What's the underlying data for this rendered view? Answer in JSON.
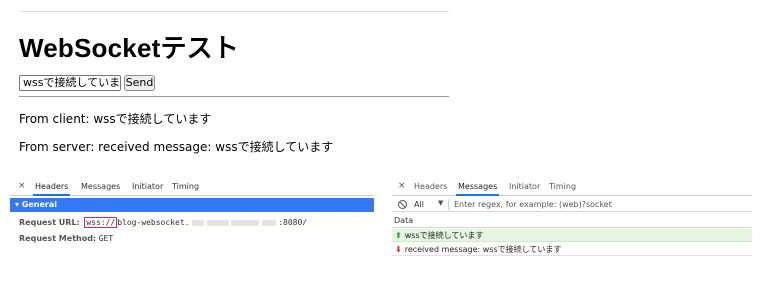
{
  "page": {
    "title": "WebSocketテスト",
    "input_value": "wssで接続しています",
    "send_label": "Send",
    "from_client": "From client: wssで接続しています",
    "from_server": "From server: received message: wssで接続しています"
  },
  "devtools_headers": {
    "close": "×",
    "tabs": [
      "Headers",
      "Messages",
      "Initiator",
      "Timing"
    ],
    "active_tab": "Headers",
    "section": "▾ General",
    "request_url_label": "Request URL:",
    "request_url_scheme": "wss://",
    "request_url_host": "blog-websocket.",
    "request_url_port": ":8080/",
    "request_method_label": "Request Method:",
    "request_method": "GET"
  },
  "devtools_messages": {
    "close": "×",
    "tabs": [
      "Headers",
      "Messages",
      "Initiator",
      "Timing"
    ],
    "active_tab": "Messages",
    "filter_all": "All",
    "filter_placeholder": "Enter regex, for example: (web)?socket",
    "data_header": "Data",
    "rows": [
      {
        "direction": "sent",
        "text": "wssで接続しています"
      },
      {
        "direction": "received",
        "text": "received message: wssで接続しています"
      }
    ]
  },
  "colors": {
    "accent": "#3478f6",
    "tab_underline": "#1a73e8",
    "sent_bg": "#e4f6df",
    "sent_arrow": "#2e9e43",
    "recv_arrow": "#d93025",
    "highlight_box": "#e0245e"
  }
}
